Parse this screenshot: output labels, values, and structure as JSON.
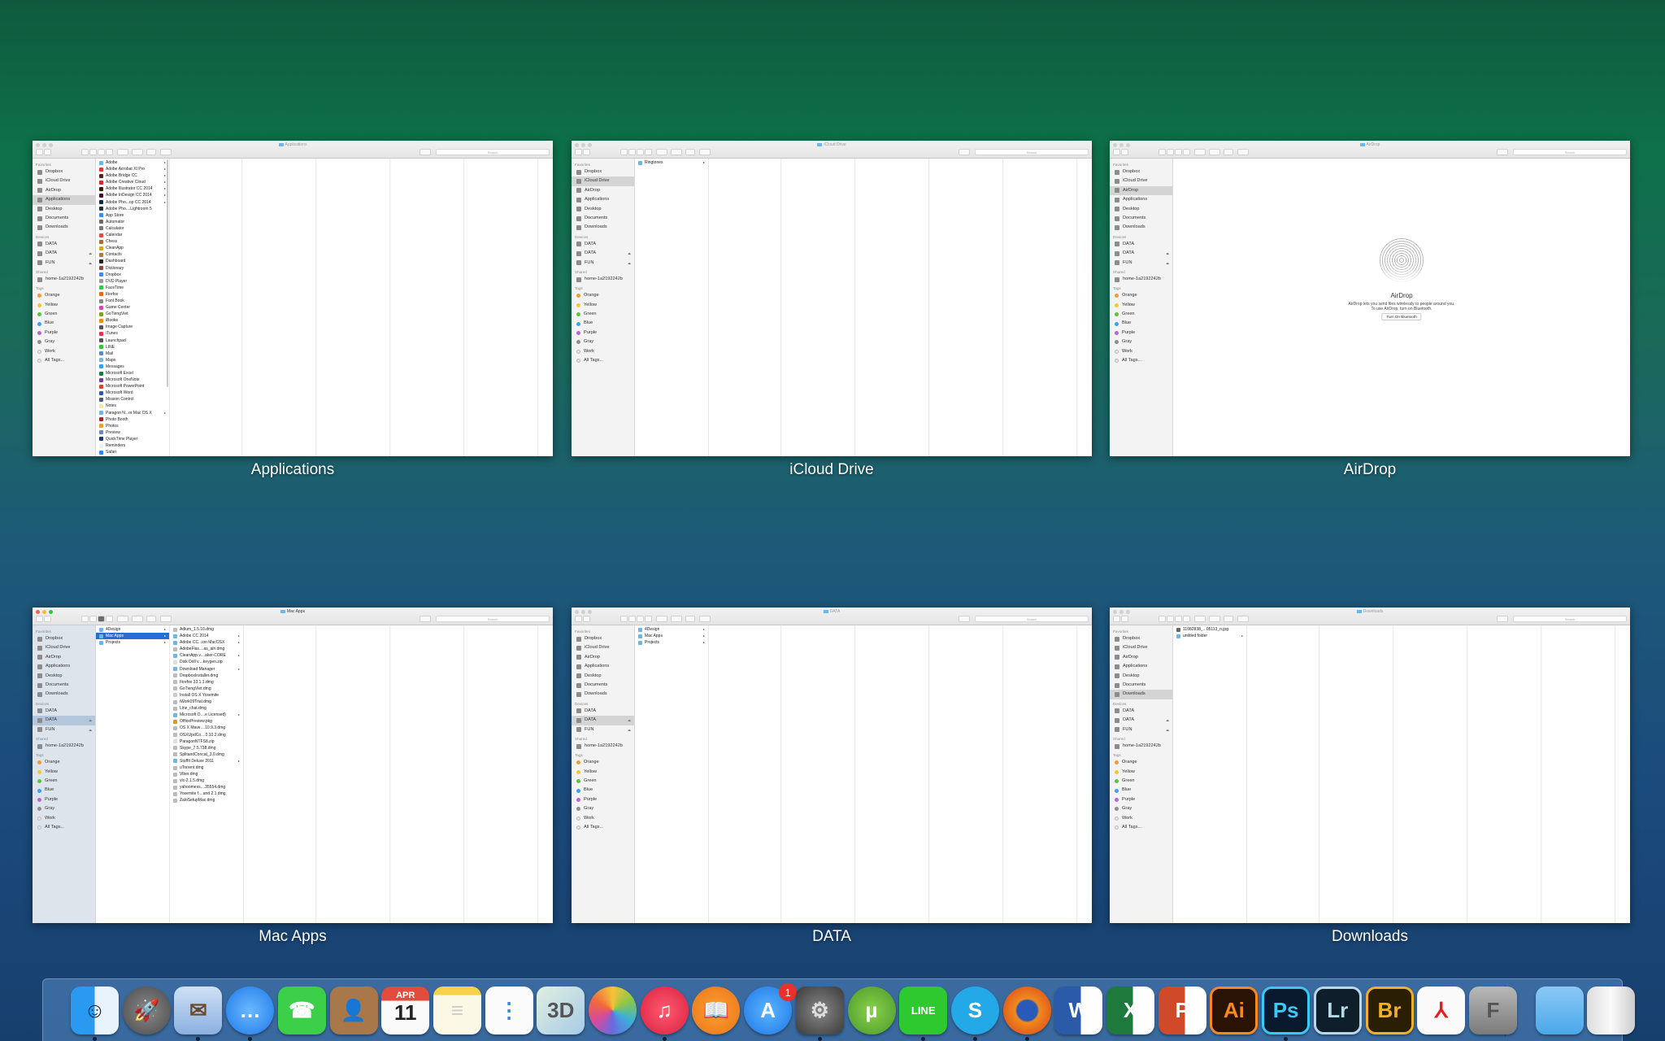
{
  "sidebar": {
    "favorites_label": "Favorites",
    "favorites": [
      "Dropbox",
      "iCloud Drive",
      "AirDrop",
      "Applications",
      "Desktop",
      "Documents",
      "Downloads"
    ],
    "devices_label": "Devices",
    "devices": [
      {
        "label": "DATA",
        "eject": false
      },
      {
        "label": "DATA",
        "eject": true
      },
      {
        "label": "FUN",
        "eject": true
      }
    ],
    "shared_label": "Shared",
    "shared": [
      "home-1a2192242b"
    ],
    "tags_label": "Tags",
    "tags": [
      {
        "label": "Orange",
        "color": "#f39a36"
      },
      {
        "label": "Yellow",
        "color": "#f2c933"
      },
      {
        "label": "Green",
        "color": "#5cc23e"
      },
      {
        "label": "Blue",
        "color": "#3aa2ef"
      },
      {
        "label": "Purple",
        "color": "#b667d4"
      },
      {
        "label": "Gray",
        "color": "#8e8e8e"
      },
      {
        "label": "Work",
        "color": "#e6e6e6"
      },
      {
        "label": "All Tags...",
        "color": "#e6e6e6"
      }
    ],
    "eject_glyph": "⏏"
  },
  "search_placeholder": "Search",
  "windows": [
    {
      "title": "Applications",
      "label": "Applications",
      "active": false,
      "sidebar_selected": "Applications",
      "columns": [
        {
          "selected": -1,
          "items": [
            {
              "n": "Adobe",
              "f": true,
              "c": "#6cb6ea"
            },
            {
              "n": "Adobe Acrobat XI Pro",
              "f": true,
              "c": "#d93b2b"
            },
            {
              "n": "Adobe Bridge CC",
              "f": true,
              "c": "#4a2d10"
            },
            {
              "n": "Adobe Creative Cloud",
              "f": true,
              "c": "#d8262c"
            },
            {
              "n": "Adobe Illustrator CC 2014",
              "f": true,
              "c": "#3a1a05"
            },
            {
              "n": "Adobe InDesign CC 2014",
              "f": true,
              "c": "#4a0b2b"
            },
            {
              "n": "Adobe Pho...op CC 2014",
              "f": true,
              "c": "#0b2a4a"
            },
            {
              "n": "Adobe Pho....Lightroom 5",
              "f": false,
              "c": "#1e3040"
            },
            {
              "n": "App Store",
              "c": "#2d8ff0"
            },
            {
              "n": "Automator",
              "c": "#6a6a6a"
            },
            {
              "n": "Calculator",
              "c": "#777"
            },
            {
              "n": "Calendar",
              "c": "#e24c3f"
            },
            {
              "n": "Chess",
              "c": "#a86c34"
            },
            {
              "n": "CleanApp",
              "c": "#e0a020"
            },
            {
              "n": "Contacts",
              "c": "#a87a45"
            },
            {
              "n": "Dashboard",
              "c": "#222"
            },
            {
              "n": "Dictionary",
              "c": "#8a4a3a"
            },
            {
              "n": "Dropbox",
              "c": "#3a8ee6"
            },
            {
              "n": "DVD Player",
              "c": "#999"
            },
            {
              "n": "FaceTime",
              "c": "#3bc54a"
            },
            {
              "n": "Firefox",
              "c": "#e8671d"
            },
            {
              "n": "Font Book",
              "c": "#888"
            },
            {
              "n": "Game Center",
              "c": "#d24ab0"
            },
            {
              "n": "GoTiengViet",
              "c": "#7ca232"
            },
            {
              "n": "iBooks",
              "c": "#f08a1e"
            },
            {
              "n": "Image Capture",
              "c": "#555"
            },
            {
              "n": "iTunes",
              "c": "#ea3350"
            },
            {
              "n": "Launchpad",
              "c": "#555"
            },
            {
              "n": "LINE",
              "c": "#3ac43a"
            },
            {
              "n": "Mail",
              "c": "#5b88c8"
            },
            {
              "n": "Maps",
              "c": "#7bb6d8"
            },
            {
              "n": "Messages",
              "c": "#3a9bf0"
            },
            {
              "n": "Microsoft Excel",
              "c": "#1e7a3c"
            },
            {
              "n": "Microsoft OneNote",
              "c": "#7a3a9a"
            },
            {
              "n": "Microsoft PowerPoint",
              "c": "#d04a2a"
            },
            {
              "n": "Microsoft Word",
              "c": "#2a5aa8"
            },
            {
              "n": "Mission Control",
              "c": "#4a5a7a"
            },
            {
              "n": "Notes",
              "c": "#f2e6a0"
            },
            {
              "n": "Paragon N...or Mac OS X",
              "f": true,
              "c": "#6cb6ea"
            },
            {
              "n": "Photo Booth",
              "c": "#a02a2a"
            },
            {
              "n": "Photos",
              "c": "#e8a030"
            },
            {
              "n": "Preview",
              "c": "#6a8ab8"
            },
            {
              "n": "QuickTime Player",
              "c": "#1a3a6a"
            },
            {
              "n": "Reminders",
              "c": "#eee"
            },
            {
              "n": "Safari",
              "c": "#2a8ae8"
            }
          ]
        }
      ]
    },
    {
      "title": "iCloud Drive",
      "label": "iCloud Drive",
      "active": false,
      "sidebar_selected": "iCloud Drive",
      "columns": [
        {
          "selected": -1,
          "items": [
            {
              "n": "Ringtones",
              "f": true,
              "c": "#6cb6ea"
            }
          ]
        }
      ]
    },
    {
      "title": "AirDrop",
      "label": "AirDrop",
      "active": false,
      "sidebar_selected": "AirDrop",
      "airdrop": {
        "title": "AirDrop",
        "line1": "AirDrop lets you send files wirelessly to people around you.",
        "line2": "To use AirDrop, turn on Bluetooth.",
        "button": "Turn On Bluetooth"
      },
      "columns": []
    },
    {
      "title": "Mac Apps",
      "label": "Mac Apps",
      "active": true,
      "sidebar_selected": "DATA#1",
      "columns": [
        {
          "selected": 1,
          "items": [
            {
              "n": "4Design",
              "f": true,
              "c": "#6cb6ea"
            },
            {
              "n": "Mac Apps",
              "f": true,
              "c": "#6cb6ea"
            },
            {
              "n": "Projects",
              "f": true,
              "c": "#6cb6ea"
            }
          ]
        },
        {
          "selected": -1,
          "items": [
            {
              "n": "Adium_1.5.10.dmg",
              "c": "#bbb"
            },
            {
              "n": "Adobe CC 2014",
              "f": true,
              "c": "#6cb6ea"
            },
            {
              "n": "Adobe CC...ion MacOSX",
              "f": true,
              "c": "#6cb6ea"
            },
            {
              "n": "AdobeFlas....as_aih.dmg",
              "c": "#bbb"
            },
            {
              "n": "CleanApp.v....aker-CORE",
              "f": true,
              "c": "#6cb6ea"
            },
            {
              "n": "Disk Drill v....keygen.zip",
              "c": "#ddd"
            },
            {
              "n": "Download Manager",
              "f": true,
              "c": "#6cb6ea"
            },
            {
              "n": "DropboxInstaller.dmg",
              "c": "#bbb"
            },
            {
              "n": "Firefox 33.1.1.dmg",
              "c": "#bbb"
            },
            {
              "n": "GoTiengViet.dmg",
              "c": "#bbb"
            },
            {
              "n": "Install OS X Yosemite",
              "c": "#ccc"
            },
            {
              "n": "iWork09Trial.dmg",
              "c": "#bbb"
            },
            {
              "n": "Line_chat.dmg",
              "c": "#bbb"
            },
            {
              "n": "Microsoft O....e Licensed)",
              "f": true,
              "c": "#6cb6ea"
            },
            {
              "n": "OfficePreview.pkg",
              "c": "#d89a2a"
            },
            {
              "n": "OS X Mave....10.9.3.dmg",
              "c": "#bbb"
            },
            {
              "n": "OSXUpdCo....0.10.2.dmg",
              "c": "#bbb"
            },
            {
              "n": "ParagonNTFS8.zip",
              "c": "#ddd"
            },
            {
              "n": "Skype_7.5.738.dmg",
              "c": "#bbb"
            },
            {
              "n": "SplitandConcat_3.0.dmg",
              "c": "#bbb"
            },
            {
              "n": "StuffIt Deluxe 2011",
              "f": true,
              "c": "#6cb6ea"
            },
            {
              "n": "uTorrent.dmg",
              "c": "#bbb"
            },
            {
              "n": "Viber.dmg",
              "c": "#bbb"
            },
            {
              "n": "vlc-2.1.5.dmg",
              "c": "#bbb"
            },
            {
              "n": "yahoomess....35554.dmg",
              "c": "#bbb"
            },
            {
              "n": "Yosemite f....and 2.1.dmg",
              "c": "#bbb"
            },
            {
              "n": "ZaloSetupMac.dmg",
              "c": "#bbb"
            }
          ]
        }
      ]
    },
    {
      "title": "DATA",
      "label": "DATA",
      "active": false,
      "sidebar_selected": "DATA#1",
      "columns": [
        {
          "selected": -1,
          "items": [
            {
              "n": "4Design",
              "f": true,
              "c": "#6cb6ea"
            },
            {
              "n": "Mac Apps",
              "f": true,
              "c": "#6cb6ea"
            },
            {
              "n": "Projects",
              "f": true,
              "c": "#6cb6ea"
            }
          ]
        }
      ]
    },
    {
      "title": "Downloads",
      "label": "Downloads",
      "active": false,
      "sidebar_selected": "Downloads",
      "columns": [
        {
          "selected": -1,
          "items": [
            {
              "n": "11082838_...05113_n.jpg",
              "c": "#666"
            },
            {
              "n": "untitled folder",
              "f": true,
              "c": "#6cb6ea"
            }
          ]
        }
      ]
    }
  ],
  "dock": [
    {
      "name": "finder",
      "bg": "linear-gradient(90deg,#2a9af0 50%,#e8f2fb 50%)",
      "glyph": "☺",
      "fg": "#123",
      "running": true
    },
    {
      "name": "launchpad",
      "bg": "radial-gradient(#8a8a8a,#4a4a4a)",
      "glyph": "🚀",
      "fg": "#222",
      "round": true
    },
    {
      "name": "mail",
      "bg": "linear-gradient(#cfe0f5,#8ab0e0)",
      "glyph": "✉",
      "fg": "#6a4a2a",
      "running": true
    },
    {
      "name": "messages",
      "bg": "radial-gradient(#6ab8ff,#1e7ae8)",
      "glyph": "…",
      "fg": "#fff",
      "round": true,
      "running": true
    },
    {
      "name": "facetime",
      "bg": "#3ccf4a",
      "glyph": "☎",
      "fg": "#fff"
    },
    {
      "name": "contacts",
      "bg": "#a8774a",
      "glyph": "👤",
      "fg": "#6a4a2a"
    },
    {
      "name": "calendar",
      "bg": "linear-gradient(#e24c3f 30%,#fafafa 30%)",
      "glyph": "11",
      "fg": "#222",
      "month": "APR"
    },
    {
      "name": "notes",
      "bg": "linear-gradient(#f5d24a 18%,#fbf8e6 18%)",
      "glyph": "≡",
      "fg": "#ccc"
    },
    {
      "name": "reminders",
      "bg": "#fbfbfb",
      "glyph": "⋮",
      "fg": "#3a8ae8"
    },
    {
      "name": "maps",
      "bg": "linear-gradient(135deg,#e0efe0,#a8cbe8)",
      "glyph": "3D",
      "fg": "#555"
    },
    {
      "name": "photos",
      "bg": "conic-gradient(#f6c23a,#8ac848,#3ab0d8,#6a6ae0,#d84a9a,#f06a3a,#f6c23a)",
      "glyph": "",
      "fg": "#fff",
      "round": true
    },
    {
      "name": "itunes",
      "bg": "radial-gradient(#ff5a72,#d9203e)",
      "glyph": "♫",
      "fg": "#fff",
      "round": true,
      "running": true
    },
    {
      "name": "ibooks",
      "bg": "radial-gradient(#ffa030,#e8741a)",
      "glyph": "📖",
      "fg": "#fff",
      "round": true
    },
    {
      "name": "app-store",
      "bg": "radial-gradient(#5ab4ff,#1e78e6)",
      "glyph": "A",
      "fg": "#fff",
      "round": true,
      "badge": "1"
    },
    {
      "name": "system-preferences",
      "bg": "radial-gradient(#888,#3a3a3a)",
      "glyph": "⚙",
      "fg": "#ddd",
      "running": true
    },
    {
      "name": "utorrent",
      "bg": "radial-gradient(#8ad04a,#4a9a2a)",
      "glyph": "µ",
      "fg": "#fff",
      "round": true
    },
    {
      "name": "line",
      "bg": "#2ec92e",
      "glyph": "LINE",
      "fg": "#fff",
      "small": true,
      "running": true
    },
    {
      "name": "skype",
      "bg": "#23a8e8",
      "glyph": "S",
      "fg": "#fff",
      "round": true,
      "running": true
    },
    {
      "name": "firefox",
      "bg": "radial-gradient(#2a5ab8 30%,#f08a1e 35%,#d8401a)",
      "glyph": "",
      "fg": "#fff",
      "round": true,
      "running": true
    },
    {
      "name": "microsoft-word",
      "bg": "linear-gradient(90deg,#2a5aa8 55%,#fff 55%)",
      "glyph": "W",
      "fg": "#fff"
    },
    {
      "name": "microsoft-excel",
      "bg": "linear-gradient(90deg,#1e7a3c 55%,#fff 55%)",
      "glyph": "X",
      "fg": "#fff"
    },
    {
      "name": "microsoft-powerpoint",
      "bg": "linear-gradient(90deg,#d04a2a 55%,#fff 55%)",
      "glyph": "P",
      "fg": "#fff"
    },
    {
      "name": "adobe-illustrator",
      "bg": "#2a1204",
      "glyph": "Ai",
      "fg": "#f7891e",
      "border": "#f7891e"
    },
    {
      "name": "adobe-photoshop",
      "bg": "#0a1a2e",
      "glyph": "Ps",
      "fg": "#3bc8f5",
      "border": "#3bc8f5",
      "running": true
    },
    {
      "name": "adobe-lightroom",
      "bg": "#0e1e2a",
      "glyph": "Lr",
      "fg": "#b8d8e8",
      "border": "#b8d8e8"
    },
    {
      "name": "adobe-bridge",
      "bg": "#2a1e04",
      "glyph": "Br",
      "fg": "#f0b02a",
      "border": "#f0b02a"
    },
    {
      "name": "adobe-acrobat",
      "bg": "#fafafa",
      "glyph": "⅄",
      "fg": "#e02020"
    },
    {
      "name": "font-book",
      "bg": "linear-gradient(#b8b8b8,#7a7a7a)",
      "glyph": "F",
      "fg": "#555"
    },
    {
      "name": "downloads-folder",
      "bg": "linear-gradient(#8ac8f5,#4aa8ea)",
      "glyph": "",
      "fg": "#fff"
    },
    {
      "name": "trash",
      "bg": "linear-gradient(90deg,#ddd,#fafafa,#ccc)",
      "glyph": "",
      "fg": "#fff"
    }
  ]
}
